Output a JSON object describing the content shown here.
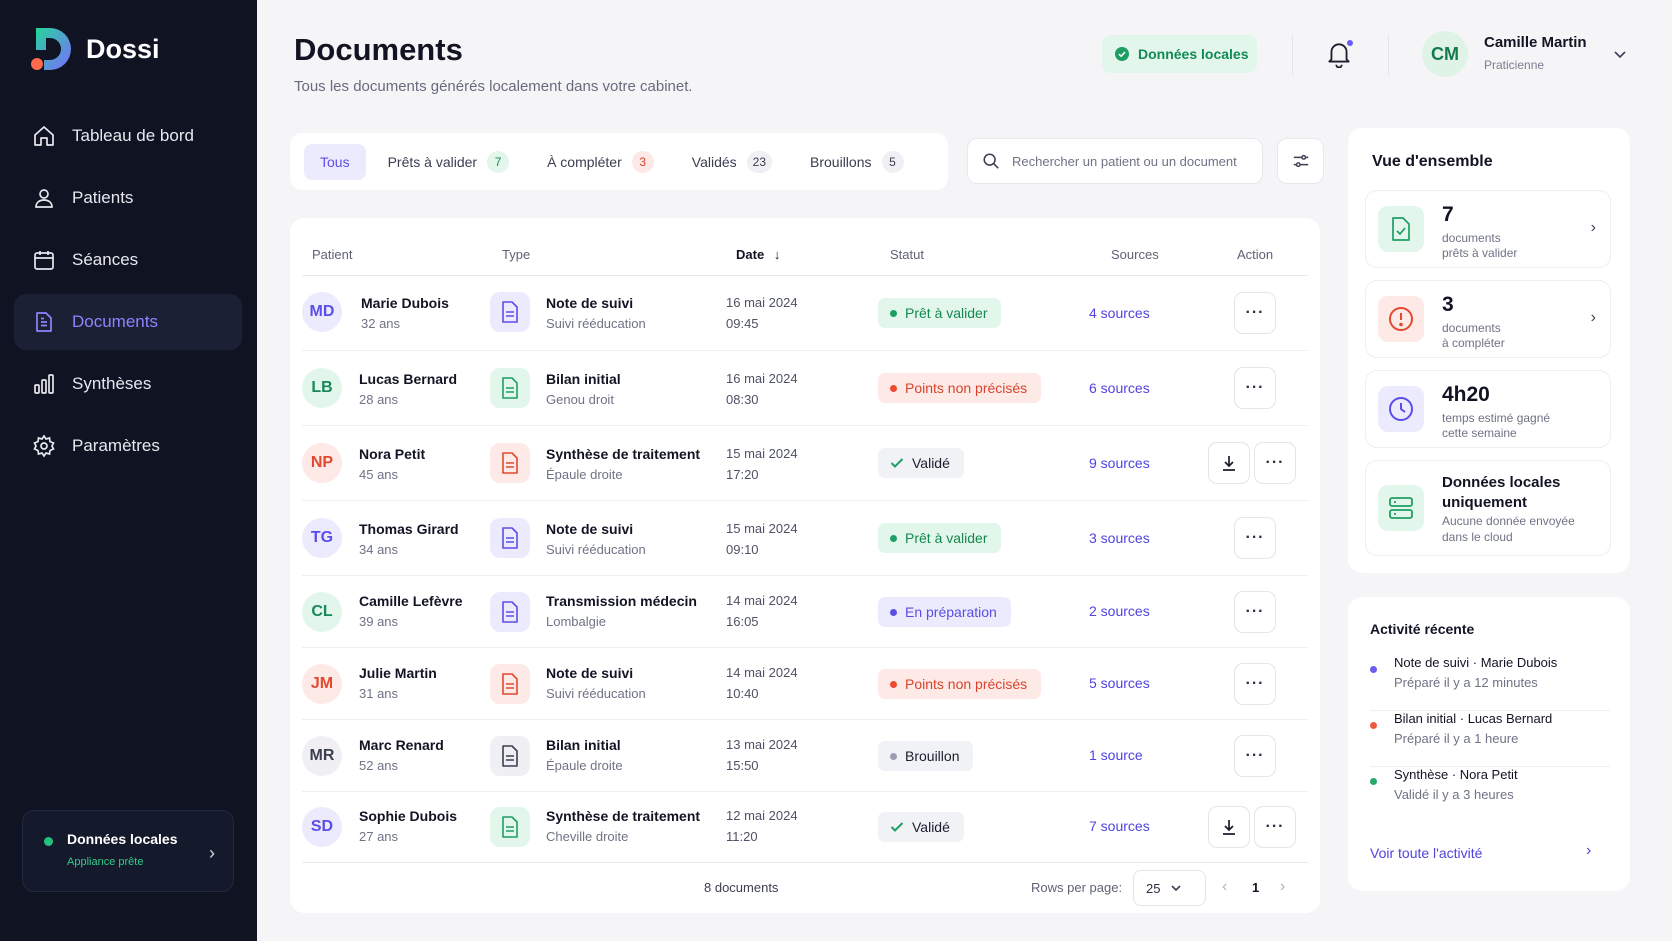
{
  "brand": {
    "name": "Dossi"
  },
  "sidebar": {
    "items": [
      {
        "label": "Tableau de bord",
        "icon": "home-icon"
      },
      {
        "label": "Patients",
        "icon": "user-icon"
      },
      {
        "label": "Séances",
        "icon": "calendar-icon"
      },
      {
        "label": "Documents",
        "icon": "document-icon",
        "active": true
      },
      {
        "label": "Synthèses",
        "icon": "bar-chart-icon"
      },
      {
        "label": "Paramètres",
        "icon": "gear-icon"
      }
    ],
    "status_card": {
      "title": "Données locales",
      "subtitle": "Appliance prête"
    }
  },
  "header": {
    "title": "Documents",
    "subtitle": "Tous les documents générés localement dans votre cabinet.",
    "local_badge": "Données locales",
    "user": {
      "initials": "CM",
      "name": "Camille Martin",
      "role": "Praticienne"
    }
  },
  "tabs": [
    {
      "label": "Tous",
      "count": ""
    },
    {
      "label": "Prêts à valider",
      "count": "7"
    },
    {
      "label": "À compléter",
      "count": "3"
    },
    {
      "label": "Validés",
      "count": "23"
    },
    {
      "label": "Brouillons",
      "count": "5"
    }
  ],
  "search": {
    "placeholder": "Rechercher un patient ou un document"
  },
  "table": {
    "columns": {
      "patient": "Patient",
      "type": "Type",
      "date": "Date",
      "status": "Statut",
      "sources": "Sources",
      "action": "Action"
    },
    "rows": [
      {
        "initials": "MD",
        "name": "Marie Dubois",
        "age": "32 ans",
        "type": "Note de suivi",
        "subtype": "Suivi rééducation",
        "date": "16 mai 2024",
        "time": "09:45",
        "status": "Prêt à valider",
        "sources": "4 sources"
      },
      {
        "initials": "LB",
        "name": "Lucas Bernard",
        "age": "28 ans",
        "type": "Bilan initial",
        "subtype": "Genou droit",
        "date": "16 mai 2024",
        "time": "08:30",
        "status": "Points non précisés",
        "sources": "6 sources"
      },
      {
        "initials": "NP",
        "name": "Nora Petit",
        "age": "45 ans",
        "type": "Synthèse de traitement",
        "subtype": "Épaule droite",
        "date": "15 mai 2024",
        "time": "17:20",
        "status": "Validé",
        "sources": "9 sources"
      },
      {
        "initials": "TG",
        "name": "Thomas Girard",
        "age": "34 ans",
        "type": "Note de suivi",
        "subtype": "Suivi rééducation",
        "date": "15 mai 2024",
        "time": "09:10",
        "status": "Prêt à valider",
        "sources": "3 sources"
      },
      {
        "initials": "CL",
        "name": "Camille Lefèvre",
        "age": "39 ans",
        "type": "Transmission médecin",
        "subtype": "Lombalgie",
        "date": "14 mai 2024",
        "time": "16:05",
        "status": "En préparation",
        "sources": "2 sources"
      },
      {
        "initials": "JM",
        "name": "Julie Martin",
        "age": "31 ans",
        "type": "Note de suivi",
        "subtype": "Suivi rééducation",
        "date": "14 mai 2024",
        "time": "10:40",
        "status": "Points non précisés",
        "sources": "5 sources"
      },
      {
        "initials": "MR",
        "name": "Marc Renard",
        "age": "52 ans",
        "type": "Bilan initial",
        "subtype": "Épaule droite",
        "date": "13 mai 2024",
        "time": "15:50",
        "status": "Brouillon",
        "sources": "1 source"
      },
      {
        "initials": "SD",
        "name": "Sophie Dubois",
        "age": "27 ans",
        "type": "Synthèse de traitement",
        "subtype": "Cheville droite",
        "date": "12 mai 2024",
        "time": "11:20",
        "status": "Validé",
        "sources": "7 sources"
      }
    ],
    "footer": {
      "count": "8 documents",
      "rows_label": "Rows per page:",
      "rows_value": "25",
      "page": "1"
    }
  },
  "overview": {
    "title": "Vue d'ensemble",
    "cards": [
      {
        "big": "7",
        "line1": "documents",
        "line2": "prêts à valider"
      },
      {
        "big": "3",
        "line1": "documents",
        "line2": "à compléter"
      },
      {
        "big": "4h20",
        "line1": "temps estimé gagné",
        "line2": "cette semaine"
      },
      {
        "title": "Données locales uniquement",
        "line1": "Aucune donnée envoyée",
        "line2": "dans le cloud"
      }
    ]
  },
  "activity": {
    "title": "Activité récente",
    "items": [
      {
        "title": "Note de suivi · Marie Dubois",
        "time": "Préparé il y a 12 minutes",
        "color": "#6b5cf5"
      },
      {
        "title": "Bilan initial · Lucas Bernard",
        "time": "Préparé il y a 1 heure",
        "color": "#ef5a3c"
      },
      {
        "title": "Synthèse · Nora Petit",
        "time": "Validé il y a 3 heures",
        "color": "#25a96b"
      }
    ],
    "link": "Voir toute l'activité"
  }
}
